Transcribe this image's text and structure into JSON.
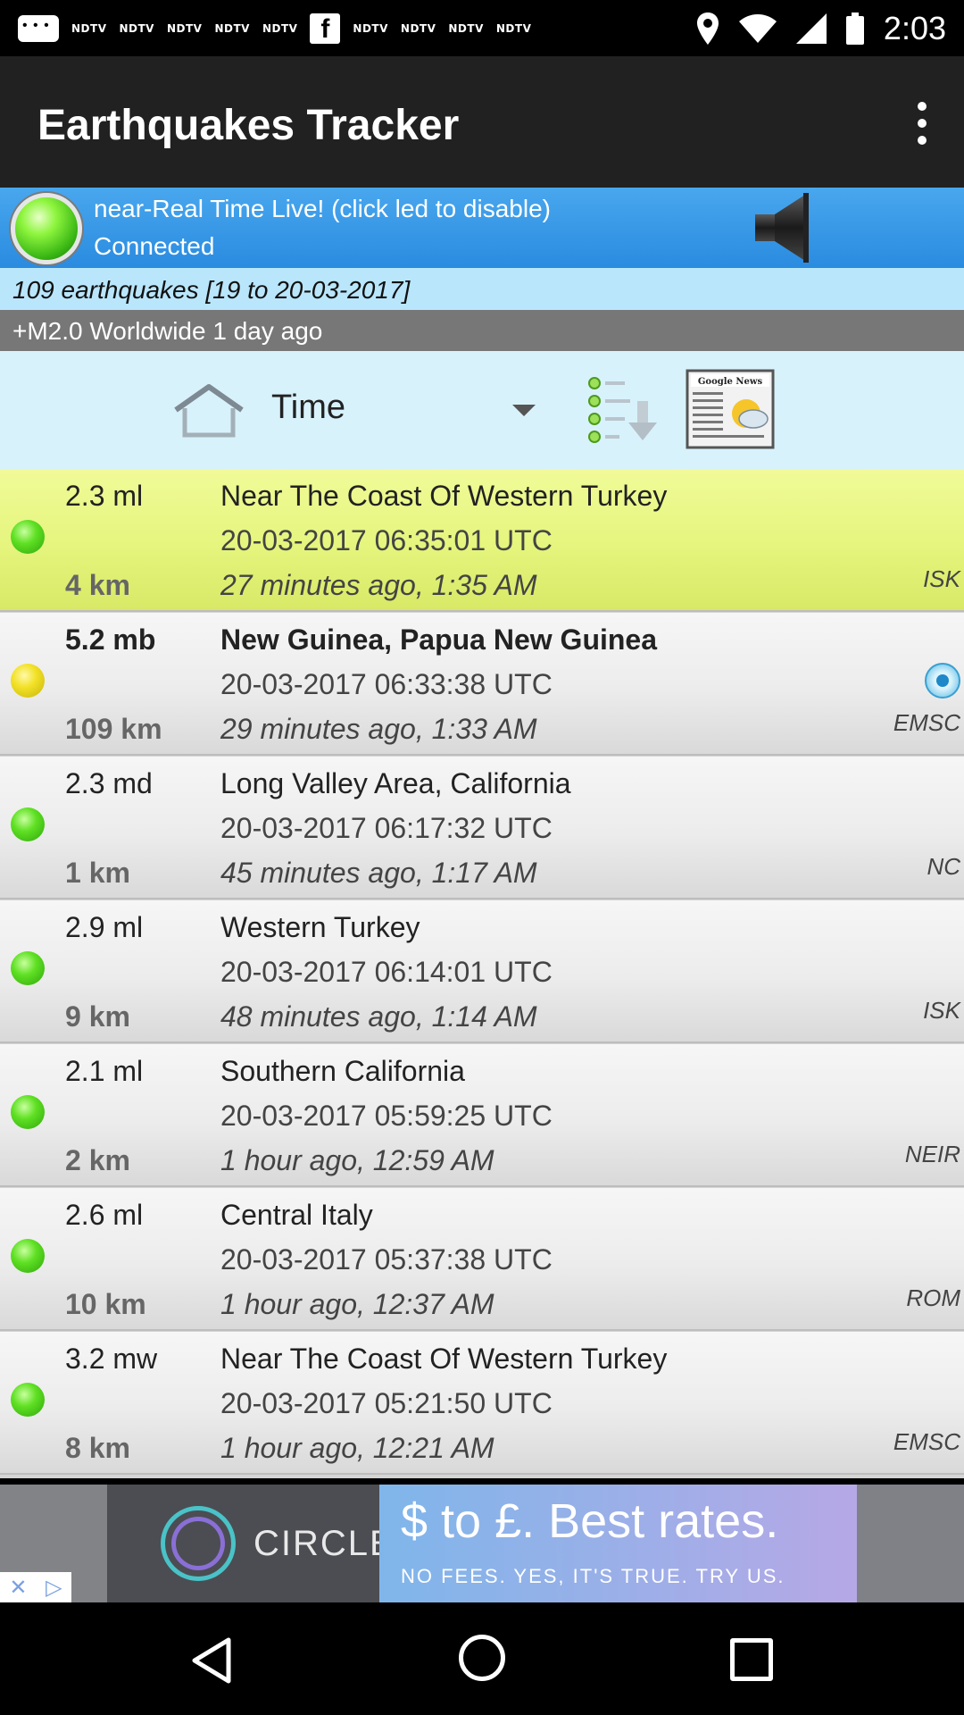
{
  "status_bar": {
    "notification_icons": [
      "chat-icon",
      "ndtv-icon",
      "ndtv-icon",
      "ndtv-icon",
      "ndtv-icon",
      "ndtv-icon",
      "facebook-icon",
      "ndtv-icon",
      "ndtv-icon",
      "ndtv-icon",
      "ndtv-icon"
    ],
    "ndtv_label": "NDTV",
    "facebook_label": "f",
    "time": "2:03",
    "system_icons": [
      "location-icon",
      "wifi-icon",
      "signal-icon",
      "battery-icon"
    ]
  },
  "app_bar": {
    "title": "Earthquakes Tracker",
    "menu_icon": "overflow-menu-icon"
  },
  "live_banner": {
    "line1": "near-Real Time Live! (click led to disable)",
    "line2": "Connected",
    "led_color": "#5fe023",
    "speaker_icon": "speaker-icon"
  },
  "summary": {
    "count_text": "109 earthquakes [19 to 20-03-2017]",
    "filter_text": "+M2.0 Worldwide 1 day ago"
  },
  "toolbar": {
    "home_icon": "home-icon",
    "sort_label": "Time",
    "sort_icon": "dropdown-caret-icon",
    "list_icon": "list-download-icon",
    "news_icon": "google-news-icon",
    "news_icon_text": "Google News"
  },
  "quakes": [
    {
      "mag": "2.3 ml",
      "depth": "4 km",
      "place": "Near The Coast Of Western Turkey",
      "utc": "20-03-2017 06:35:01 UTC",
      "ago": "27 minutes ago, 1:35 AM",
      "source": "ISK",
      "dot": "green"
    },
    {
      "mag": "5.2 mb",
      "depth": "109 km",
      "place": "New Guinea, Papua New Guinea",
      "utc": "20-03-2017 06:33:38 UTC",
      "ago": "29 minutes ago, 1:33 AM",
      "source": "EMSC",
      "dot": "yellow"
    },
    {
      "mag": "2.3 md",
      "depth": "1 km",
      "place": "Long Valley Area, California",
      "utc": "20-03-2017 06:17:32 UTC",
      "ago": "45 minutes ago, 1:17 AM",
      "source": "NC",
      "dot": "green"
    },
    {
      "mag": "2.9 ml",
      "depth": "9 km",
      "place": "Western Turkey",
      "utc": "20-03-2017 06:14:01 UTC",
      "ago": "48 minutes ago, 1:14 AM",
      "source": "ISK",
      "dot": "green"
    },
    {
      "mag": "2.1 ml",
      "depth": "2 km",
      "place": "Southern California",
      "utc": "20-03-2017 05:59:25 UTC",
      "ago": "1 hour ago, 12:59 AM",
      "source": "NEIR",
      "dot": "green"
    },
    {
      "mag": "2.6 ml",
      "depth": "10 km",
      "place": "Central Italy",
      "utc": "20-03-2017 05:37:38 UTC",
      "ago": "1 hour ago, 12:37 AM",
      "source": "ROM",
      "dot": "green"
    },
    {
      "mag": "3.2 mw",
      "depth": "8 km",
      "place": "Near The Coast Of Western Turkey",
      "utc": "20-03-2017 05:21:50 UTC",
      "ago": "1 hour ago, 12:21 AM",
      "source": "EMSC",
      "dot": "green"
    }
  ],
  "ad": {
    "brand": "CIRCLE",
    "headline": "$ to £. Best rates.",
    "subline": "NO FEES. YES, IT'S TRUE. TRY US.",
    "close_icon": "close-icon",
    "adchoices_icon": "adchoices-icon"
  },
  "nav_bar": {
    "back_icon": "back-icon",
    "home_icon": "home-circle-icon",
    "recents_icon": "recents-icon"
  },
  "colors": {
    "app_bar": "#212121",
    "live_banner": "#2a8be0",
    "count_bar": "#b9e6fb",
    "filter_bar": "#777777",
    "toolbar": "#d8f2fc",
    "highlight_row": "#e5f57d"
  }
}
